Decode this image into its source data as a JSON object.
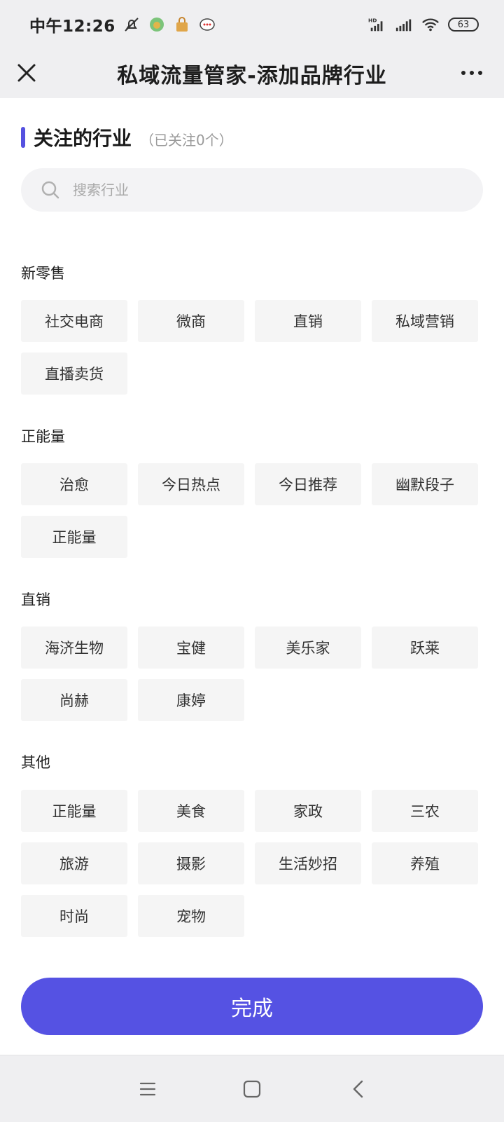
{
  "status_bar": {
    "time": "中午12:26",
    "battery": "63",
    "icons": [
      "mute-icon",
      "app-icon",
      "lock-app-icon",
      "chat-icon",
      "hd-signal-icon",
      "signal-icon",
      "wifi-icon",
      "battery-icon"
    ]
  },
  "header": {
    "title": "私域流量管家-添加品牌行业",
    "close_icon": "close-icon",
    "more_icon": "more-icon"
  },
  "follow": {
    "title": "关注的行业",
    "count_text": "（已关注0个）"
  },
  "search": {
    "placeholder": "搜索行业",
    "value": ""
  },
  "sections": [
    {
      "label": "新零售",
      "tags": [
        "社交电商",
        "微商",
        "直销",
        "私域营销",
        "直播卖货"
      ]
    },
    {
      "label": "正能量",
      "tags": [
        "治愈",
        "今日热点",
        "今日推荐",
        "幽默段子",
        "正能量"
      ]
    },
    {
      "label": "直销",
      "tags": [
        "海济生物",
        "宝健",
        "美乐家",
        "跃莱",
        "尚赫",
        "康婷"
      ]
    },
    {
      "label": "其他",
      "tags": [
        "正能量",
        "美食",
        "家政",
        "三农",
        "旅游",
        "摄影",
        "生活妙招",
        "养殖",
        "时尚",
        "宠物"
      ]
    }
  ],
  "done_button": "完成",
  "colors": {
    "accent": "#5552e3",
    "tag_bg": "#f5f5f5",
    "bar_bg": "#efeff1"
  },
  "nav": [
    "menu-icon",
    "home-icon",
    "back-icon"
  ]
}
